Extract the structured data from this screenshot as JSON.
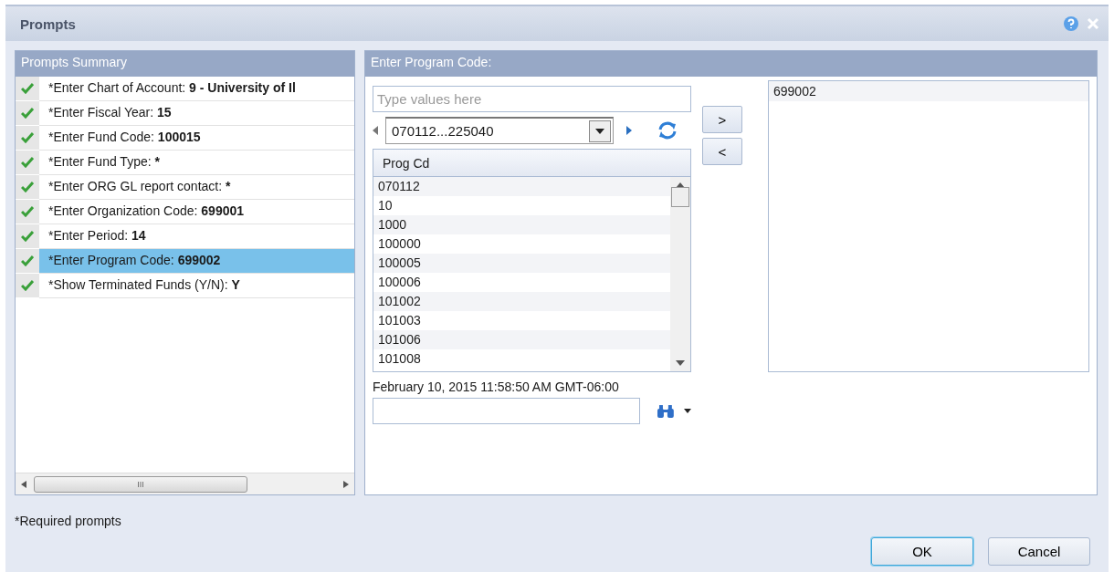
{
  "window": {
    "title": "Prompts"
  },
  "summary": {
    "title": "Prompts Summary",
    "prompts": [
      {
        "label": "*Enter Chart of Account:",
        "value": "9 - University of Il",
        "done": true,
        "selected": false
      },
      {
        "label": "*Enter Fiscal Year:",
        "value": "15",
        "done": true,
        "selected": false
      },
      {
        "label": "*Enter Fund Code:",
        "value": "100015",
        "done": true,
        "selected": false
      },
      {
        "label": "*Enter Fund Type:",
        "value": "*",
        "done": true,
        "selected": false
      },
      {
        "label": "*Enter ORG GL report contact:",
        "value": "*",
        "done": true,
        "selected": false
      },
      {
        "label": "*Enter Organization Code:",
        "value": "699001",
        "done": true,
        "selected": false
      },
      {
        "label": "*Enter Period:",
        "value": "14",
        "done": true,
        "selected": false
      },
      {
        "label": "*Enter Program Code:",
        "value": "699002",
        "done": true,
        "selected": true
      },
      {
        "label": "*Show Terminated Funds (Y/N):",
        "value": "Y",
        "done": true,
        "selected": false
      }
    ],
    "scroll_thumb": "III"
  },
  "editor": {
    "title": "Enter Program Code:",
    "search": {
      "placeholder": "Type values here"
    },
    "range": "070112...225040",
    "add_button": ">",
    "remove_button": "<",
    "list": {
      "column": "Prog Cd",
      "values": [
        "070112",
        "10",
        "1000",
        "100000",
        "100005",
        "100006",
        "101002",
        "101003",
        "101006",
        "101008"
      ]
    },
    "refreshed": "February 10, 2015 11:58:50 AM GMT-06:00",
    "selected_values": [
      "699002"
    ]
  },
  "footnote": "*Required prompts",
  "buttons": [
    {
      "label": "OK",
      "default": true
    },
    {
      "label": "Cancel",
      "default": false
    }
  ]
}
